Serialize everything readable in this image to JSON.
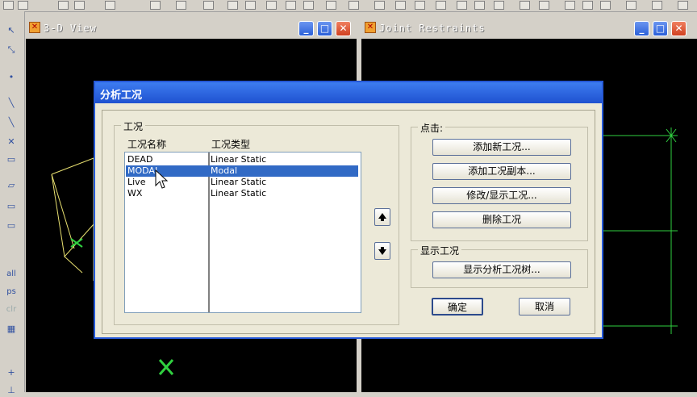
{
  "views": {
    "left_title": "3-D View",
    "right_title": "Joint Restraints"
  },
  "window_buttons": {
    "minimize": "_",
    "maximize": "□",
    "close": "✕"
  },
  "dialog": {
    "title": "分析工况",
    "cases_group": "工况",
    "col_name": "工况名称",
    "col_type": "工况类型",
    "rows": [
      {
        "name": "DEAD",
        "type": "Linear Static",
        "selected": false
      },
      {
        "name": "MODAL",
        "type": "Modal",
        "selected": true
      },
      {
        "name": "Live",
        "type": "Linear Static",
        "selected": false
      },
      {
        "name": "WX",
        "type": "Linear Static",
        "selected": false
      }
    ],
    "click_group": "点击:",
    "add_new": "添加新工况...",
    "add_copy": "添加工况副本...",
    "modify_show": "修改/显示工况...",
    "delete": "删除工况",
    "show_group": "显示工况",
    "show_tree": "显示分析工况树...",
    "ok": "确定",
    "cancel": "取消"
  },
  "left_toolbar_labels": [
    "all",
    "ps",
    "clr"
  ]
}
